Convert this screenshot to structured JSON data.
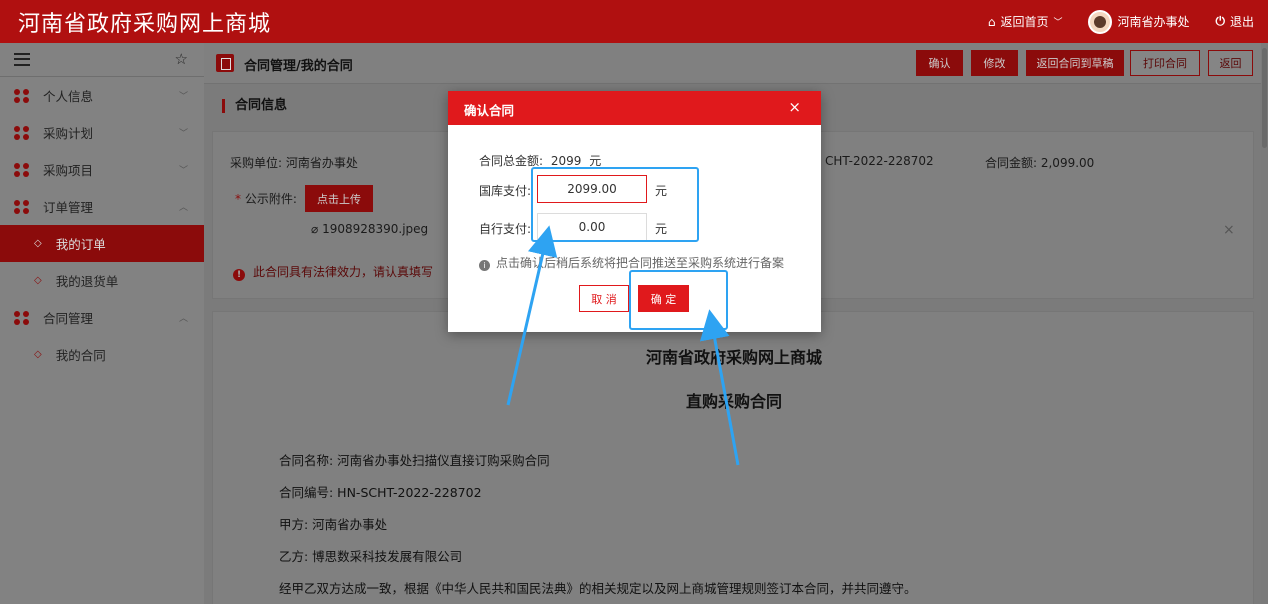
{
  "app": {
    "brand": "河南省政府采购网上商城"
  },
  "topnav": {
    "home": "返回首页",
    "user": "河南省办事处",
    "logout": "退出"
  },
  "sidebar": {
    "items": [
      {
        "label": "个人信息",
        "chevron": "﹀"
      },
      {
        "label": "采购计划",
        "chevron": "﹀"
      },
      {
        "label": "采购项目",
        "chevron": "﹀"
      },
      {
        "label": "订单管理",
        "chevron": "︿",
        "subs": [
          "我的订单",
          "我的退货单"
        ]
      },
      {
        "label": "合同管理",
        "chevron": "︿",
        "subs": [
          "我的合同"
        ]
      }
    ]
  },
  "breadcrumb": {
    "title": "合同管理/我的合同"
  },
  "toolbar": {
    "confirm": "确认",
    "edit": "修改",
    "return_draft": "返回合同到草稿",
    "print": "打印合同",
    "back": "返回"
  },
  "section": {
    "title": "合同信息"
  },
  "info": {
    "buyer_label": "采购单位: 河南省办事处",
    "contract_no_partial": "CHT-2022-228702",
    "amount": "合同金额: 2,099.00",
    "attachment_label": "公示附件:",
    "required_mark": "*",
    "upload": "点击上传",
    "filename": "1908928390.jpeg",
    "remove": "×",
    "warning": "此合同具有法律效力，请认真填写"
  },
  "contract": {
    "heading1": "河南省政府采购网上商城",
    "heading2": "直购采购合同",
    "lines": [
      "合同名称: 河南省办事处扫描仪直接订购采购合同",
      "合同编号: HN-SCHT-2022-228702",
      "甲方: 河南省办事处",
      "乙方: 博思数采科技发展有限公司",
      "经甲乙双方达成一致，根据《中华人民共和国民法典》的相关规定以及网上商城管理规则签订本合同，并共同遵守。"
    ]
  },
  "modal": {
    "title": "确认合同",
    "close": "×",
    "total_label": "合同总金额:",
    "total_value": "2099",
    "unit": "元",
    "treasury_label": "国库支付:",
    "treasury_value": "2099.00",
    "self_label": "自行支付:",
    "self_value": "0.00",
    "note": "点击确认后稍后系统将把合同推送至采购系统进行备案",
    "cancel": "取 消",
    "ok": "确 定"
  },
  "colors": {
    "primary": "#e0191c",
    "header": "#b01010",
    "annotation": "#2ea3f2"
  }
}
